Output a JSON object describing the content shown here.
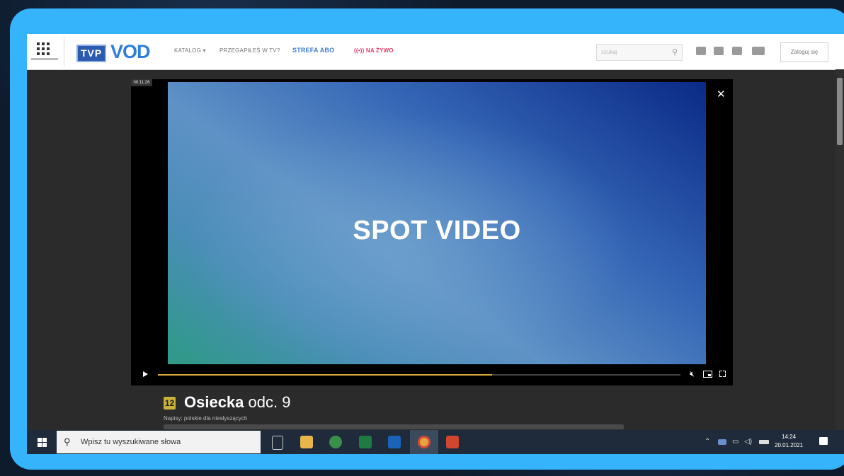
{
  "nav": {
    "catalog": "KATALOG",
    "missed": "PRZEGAPIŁEŚ W TV?",
    "abo": "STREFA ABO",
    "live": "NA ŻYWO",
    "logo_tvp": "TVP",
    "logo_vod": "VOD",
    "search_placeholder": "szukaj",
    "login": "Zaloguj się"
  },
  "player": {
    "timecode": "00:11:26",
    "overlay_text": "SPOT VIDEO",
    "progress": 0.64
  },
  "episode": {
    "age_rating": "12",
    "title": "Osiecka",
    "episode": "odc. 9",
    "subtitles_info": "Napisy: polskie dla niesłyszących"
  },
  "taskbar": {
    "search_placeholder": "Wpisz tu wyszukiwane słowa",
    "time": "14:24",
    "date": "20.01.2021"
  },
  "colors": {
    "frame": "#36b4fb",
    "accent_vod": "#2f7fd8",
    "live": "#e33d6a",
    "progress": "#d6a73c"
  }
}
